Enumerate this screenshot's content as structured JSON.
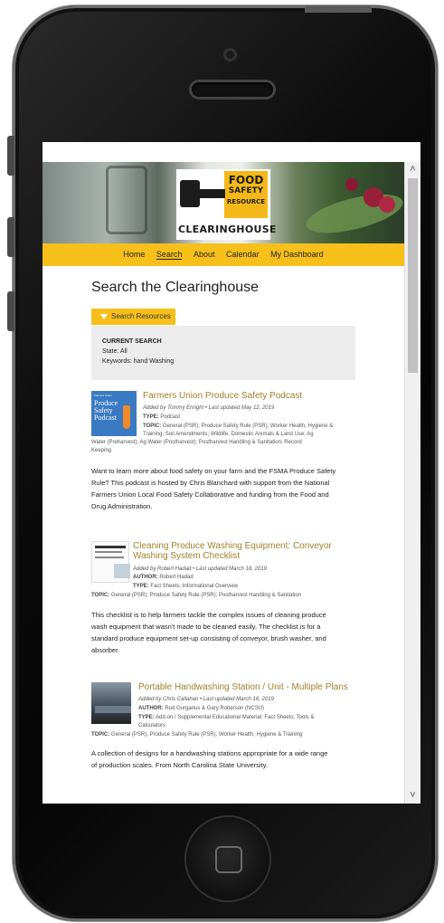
{
  "nav": {
    "items": [
      "Home",
      "Search",
      "About",
      "Calendar",
      "My Dashboard"
    ],
    "active": "Search"
  },
  "logo": {
    "line1": "FOOD",
    "line2": "SAFETY",
    "line3": "RESOURCE",
    "bottom": "CLEARINGHOUSE"
  },
  "page": {
    "title": "Search the Clearinghouse",
    "tab_label": "Search Resources"
  },
  "current_search": {
    "heading": "CURRENT SEARCH",
    "state_label": "State:",
    "state_value": "All",
    "keywords_label": "Keywords:",
    "keywords_value": "hand Washing"
  },
  "results": [
    {
      "title": "Farmers Union Produce Safety Podcast",
      "meta": "Added by Tommy Enright • Last updated May 12, 2019",
      "type": "Podcast",
      "topic_l1": "General (PSR); Produce Safety Rule (PSR); Worker Health, Hygiene &",
      "topic_l2": "Training; Soil Amendments; Wildlife, Domestic Animals & Land Use; Ag",
      "topic_l3": "Water (Preharvest); Ag Water (Postharvest); Postharvest Handling & Sanitation; Record",
      "topic_l4": "Keeping",
      "desc_l1": "Want to learn more about food safety on your farm and the FSMA Produce Safety",
      "desc_l2": "Rule? This podcast is hosted by Chris Blanchard with support from the National",
      "desc_l3": "Farmers Union Local Food Safety Collaborative and funding from the Food and",
      "desc_l4": "Drug Administration.",
      "thumb_small": "Farmers Union",
      "thumb_l1": "Produce",
      "thumb_l2": "Safety",
      "thumb_l3": "Podcast"
    },
    {
      "title_l1": "Cleaning Produce Washing Equipment: Conveyor",
      "title_l2": "Washing System Checklist",
      "meta": "Added by Robert Hadad • Last updated March 18, 2019",
      "author": "Robert Hadad",
      "type": "Fact Sheets; Informational Overview",
      "topic": "General (PSR); Produce Safety Rule (PSR); Postharvest Handling & Sanitation",
      "desc_l1": "This checklist is to help farmers tackle the complex issues of cleaning produce",
      "desc_l2": "wash equipment that wasn't made to be cleaned easily. The checklist is for a",
      "desc_l3": "standard produce equipment set-up consisting of conveyor, brush washer, and",
      "desc_l4": "absorber."
    },
    {
      "title": "Portable Handwashing Station / Unit - Multiple Plans",
      "meta": "Added by Chris Callahan • Last updated March 16, 2019",
      "author_l1": "Rod Gurganus & Gary Roberson (NCSU)",
      "type_l1": "Add-on / Supplemental Educational Material; Fact Sheets; Tools &",
      "type_l2": "Calculators",
      "topic": "General (PSR); Produce Safety Rule (PSR); Worker Health, Hygiene & Training",
      "desc_l1": "A collection of designs for a handwashing stations appropriate for a wide range",
      "desc_l2": "of production scales. From North Carolina State University."
    }
  ],
  "labels": {
    "type": "TYPE:",
    "topic": "TOPIC:",
    "author": "AUTHOR:"
  }
}
